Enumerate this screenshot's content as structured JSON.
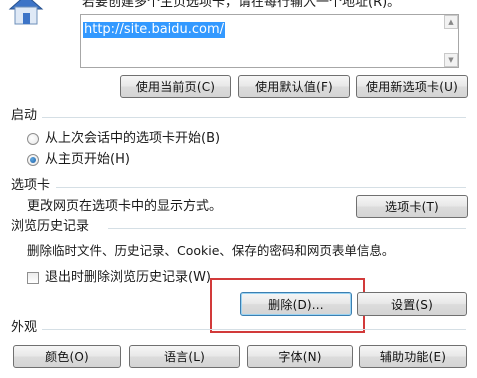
{
  "homepage": {
    "instruction": "若要创建多个主页选项卡，请在每行输入一个地址(R)。",
    "url_value": "http://site.baidu.com/",
    "buttons": {
      "use_current": "使用当前页(C)",
      "use_default": "使用默认值(F)",
      "use_new_tab": "使用新选项卡(U)"
    }
  },
  "startup": {
    "title": "启动",
    "options": [
      {
        "label": "从上次会话中的选项卡开始(B)",
        "selected": false
      },
      {
        "label": "从主页开始(H)",
        "selected": true
      }
    ]
  },
  "tabs": {
    "title": "选项卡",
    "description": "更改网页在选项卡中的显示方式。",
    "button": "选项卡(T)"
  },
  "history": {
    "title": "浏览历史记录",
    "description": "删除临时文件、历史记录、Cookie、保存的密码和网页表单信息。",
    "checkbox_label": "退出时删除浏览历史记录(W)",
    "checkbox_checked": false,
    "delete_button": "删除(D)...",
    "settings_button": "设置(S)",
    "highlight_color": "#d23a3a"
  },
  "appearance": {
    "title": "外观",
    "buttons": {
      "colors": "颜色(O)",
      "languages": "语言(L)",
      "fonts": "字体(N)",
      "accessibility": "辅助功能(E)"
    }
  }
}
